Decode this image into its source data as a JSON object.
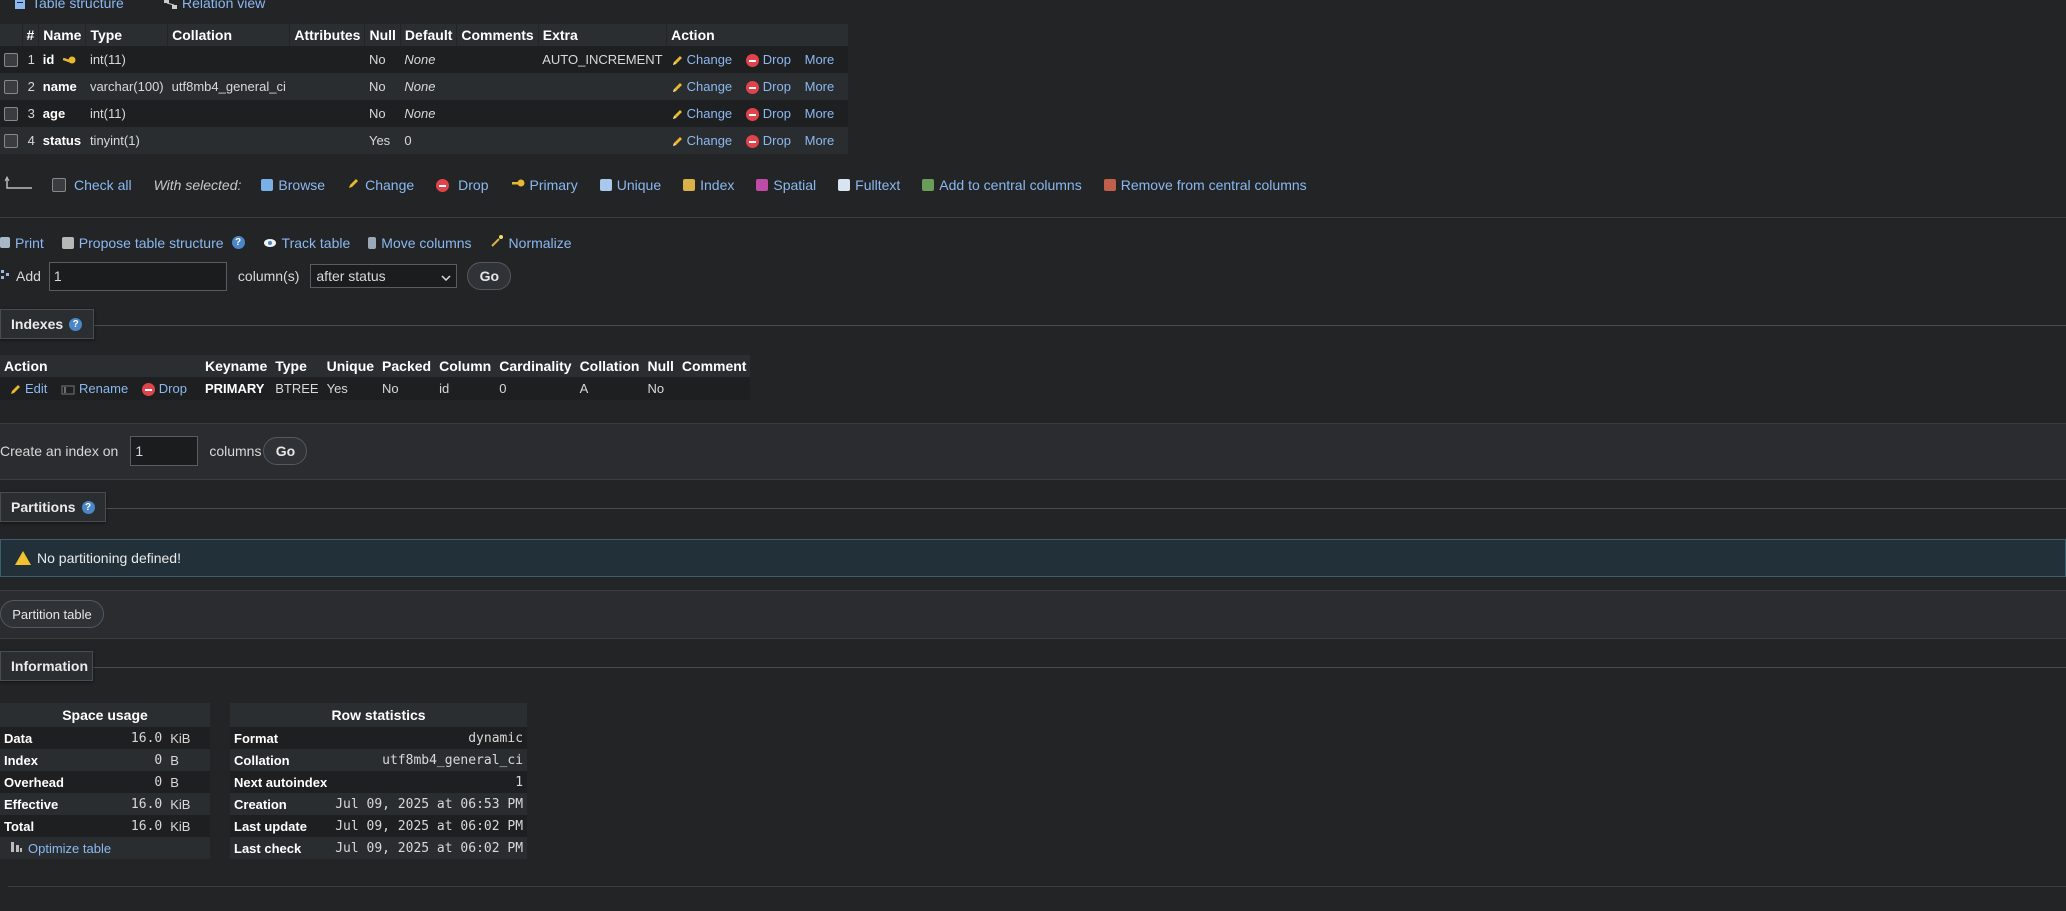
{
  "tabs": [
    {
      "label": "Table structure",
      "icon": "table-structure-icon"
    },
    {
      "label": "Relation view",
      "icon": "relation-view-icon"
    }
  ],
  "structure": {
    "headers": [
      "#",
      "Name",
      "Type",
      "Collation",
      "Attributes",
      "Null",
      "Default",
      "Comments",
      "Extra",
      "Action"
    ],
    "rows": [
      {
        "num": "1",
        "name": "id",
        "type": "int(11)",
        "collation": "",
        "attributes": "",
        "null": "No",
        "default": "None",
        "comments": "",
        "extra": "AUTO_INCREMENT",
        "primary_key": true
      },
      {
        "num": "2",
        "name": "name",
        "type": "varchar(100)",
        "collation": "utf8mb4_general_ci",
        "attributes": "",
        "null": "No",
        "default": "None",
        "comments": "",
        "extra": "",
        "primary_key": false
      },
      {
        "num": "3",
        "name": "age",
        "type": "int(11)",
        "collation": "",
        "attributes": "",
        "null": "No",
        "default": "None",
        "comments": "",
        "extra": "",
        "primary_key": false
      },
      {
        "num": "4",
        "name": "status",
        "type": "tinyint(1)",
        "collation": "",
        "attributes": "",
        "null": "Yes",
        "default": "0",
        "comments": "",
        "extra": "",
        "primary_key": false
      }
    ],
    "actions": {
      "change": "Change",
      "drop": "Drop",
      "more": "More"
    }
  },
  "bulk": {
    "check_all": "Check all",
    "with_selected": "With selected:",
    "buttons": [
      {
        "label": "Browse",
        "icon": "browse-icon"
      },
      {
        "label": "Change",
        "icon": "pencil-icon"
      },
      {
        "label": "Drop",
        "icon": "drop-icon"
      },
      {
        "label": "Primary",
        "icon": "key-icon"
      },
      {
        "label": "Unique",
        "icon": "unique-icon"
      },
      {
        "label": "Index",
        "icon": "index-icon"
      },
      {
        "label": "Spatial",
        "icon": "spatial-icon"
      },
      {
        "label": "Fulltext",
        "icon": "fulltext-icon"
      },
      {
        "label": "Add to central columns",
        "icon": "add-central-icon"
      },
      {
        "label": "Remove from central columns",
        "icon": "remove-central-icon"
      }
    ]
  },
  "tools": {
    "print": "Print",
    "propose": "Propose table structure",
    "track": "Track table",
    "move": "Move columns",
    "normalize": "Normalize"
  },
  "add_columns": {
    "label": "Add",
    "value": "1",
    "suffix": "column(s)",
    "position": "after status",
    "go": "Go"
  },
  "indexes": {
    "title": "Indexes",
    "headers": [
      "Action",
      "Keyname",
      "Type",
      "Unique",
      "Packed",
      "Column",
      "Cardinality",
      "Collation",
      "Null",
      "Comment"
    ],
    "actions": {
      "edit": "Edit",
      "rename": "Rename",
      "drop": "Drop"
    },
    "row": {
      "keyname": "PRIMARY",
      "type": "BTREE",
      "unique": "Yes",
      "packed": "No",
      "column": "id",
      "cardinality": "0",
      "collation": "A",
      "null": "No",
      "comment": ""
    },
    "create_label": "Create an index on",
    "create_value": "1",
    "create_suffix": "columns",
    "go": "Go"
  },
  "partitions": {
    "title": "Partitions",
    "message": "No partitioning defined!",
    "button": "Partition table"
  },
  "information": {
    "title": "Information",
    "space_title": "Space usage",
    "space": [
      {
        "label": "Data",
        "value": "16.0",
        "unit": "KiB"
      },
      {
        "label": "Index",
        "value": "0",
        "unit": "B"
      },
      {
        "label": "Overhead",
        "value": "0",
        "unit": "B"
      },
      {
        "label": "Effective",
        "value": "16.0",
        "unit": "KiB"
      },
      {
        "label": "Total",
        "value": "16.0",
        "unit": "KiB"
      }
    ],
    "optimize": "Optimize table",
    "row_title": "Row statistics",
    "rowstats": [
      {
        "label": "Format",
        "value": "dynamic"
      },
      {
        "label": "Collation",
        "value": "utf8mb4_general_ci"
      },
      {
        "label": "Next autoindex",
        "value": "1"
      },
      {
        "label": "Creation",
        "value": "Jul 09, 2025 at 06:53 PM"
      },
      {
        "label": "Last update",
        "value": "Jul 09, 2025 at 06:02 PM"
      },
      {
        "label": "Last check",
        "value": "Jul 09, 2025 at 06:02 PM"
      }
    ]
  },
  "colors": {
    "background": "#222426",
    "link": "#8bb8f0",
    "header_bg": "#2b2e31",
    "drop_red": "#e0444a",
    "warning_bg": "#223139",
    "warning_icon": "#f2c12e"
  }
}
